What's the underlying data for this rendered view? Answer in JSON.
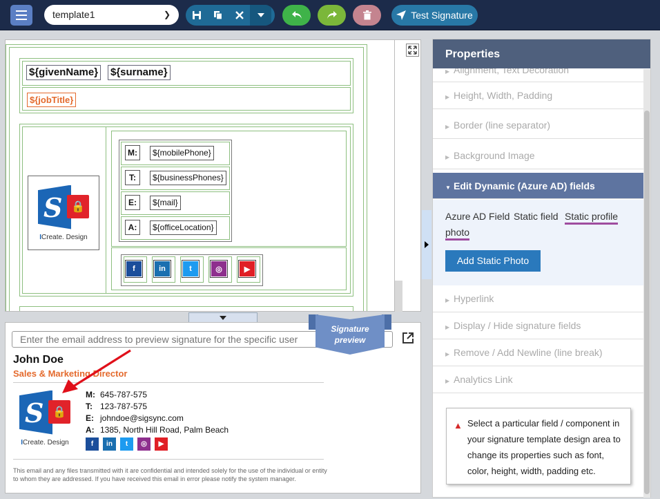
{
  "toolbar": {
    "template_value": "template1",
    "test_label": "Test Signature"
  },
  "design": {
    "given": "${givenName}",
    "surname": "${surname}",
    "jobtitle": "${jobTitle}",
    "rows": [
      {
        "label": "M:",
        "value": "${mobilePhone}"
      },
      {
        "label": "T:",
        "value": "${businessPhones}"
      },
      {
        "label": "E:",
        "value": "${mail}"
      },
      {
        "label": "A:",
        "value": "${officeLocation}"
      }
    ],
    "logo_caption_a": "I",
    "logo_caption_b": "Create. Design"
  },
  "preview": {
    "search_placeholder": "Enter the email address to preview signature for the specific user",
    "ribbon_line1": "Signature",
    "ribbon_line2": "preview",
    "name": "John Doe",
    "title": "Sales & Marketing Director",
    "rows": [
      {
        "label": "M:",
        "value": "645-787-575"
      },
      {
        "label": "T:",
        "value": "123-787-575"
      },
      {
        "label": "E:",
        "value": "johndoe@sigsync.com"
      },
      {
        "label": "A:",
        "value": "1385, North Hill Road, Palm Beach"
      }
    ],
    "disclaimer": "This email and any files transmitted with it are confidential and intended solely for the use of the individual or entity to whom they are addressed. If you have received this email in error please notify the system manager."
  },
  "properties": {
    "title": "Properties",
    "sections_top": [
      "Alignment, Text Decoration",
      "Height, Width, Padding",
      "Border (line separator)",
      "Background Image"
    ],
    "active_section": "Edit Dynamic (Azure AD) fields",
    "subtabs": [
      "Azure AD Field",
      "Static field",
      "Static profile",
      "photo"
    ],
    "add_photo": "Add Static Photo",
    "sections_bottom": [
      "Hyperlink",
      "Display / Hide signature fields",
      "Remove / Add Newline (line break)",
      "Analytics Link"
    ],
    "info": "Select a particular field / component in your signature template design area to change its properties such as font, color, height, width, padding etc."
  },
  "social": [
    {
      "icon": "facebook-icon",
      "glyph": "f",
      "color": "#1b4e9b"
    },
    {
      "icon": "linkedin-icon",
      "glyph": "in",
      "color": "#1a6fb0"
    },
    {
      "icon": "twitter-icon",
      "glyph": "t",
      "color": "#1d9bf0"
    },
    {
      "icon": "instagram-icon",
      "glyph": "◎",
      "color": "#8e2f8e"
    },
    {
      "icon": "youtube-icon",
      "glyph": "▶",
      "color": "#e01f26"
    }
  ]
}
